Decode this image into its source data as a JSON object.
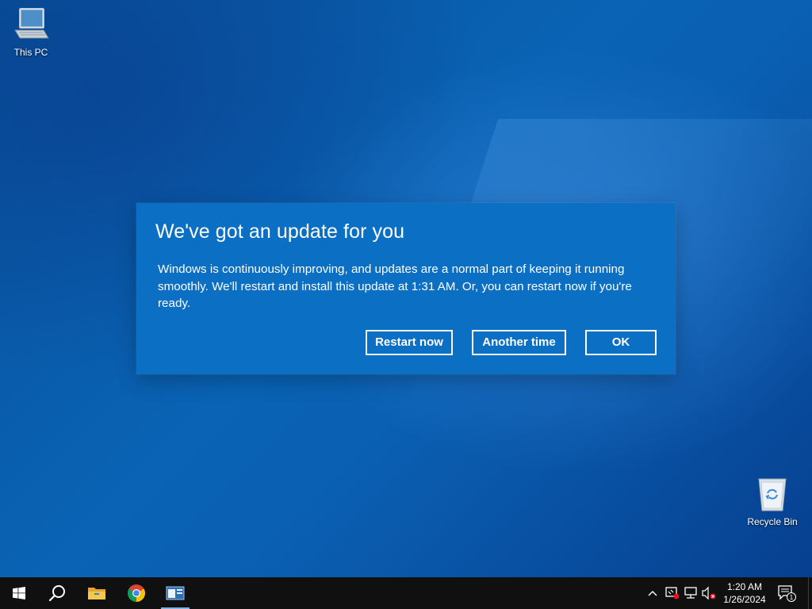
{
  "desktop": {
    "icons": [
      {
        "label": "This PC",
        "icon": "computer-icon"
      },
      {
        "label": "Recycle Bin",
        "icon": "recycle-bin-icon"
      }
    ]
  },
  "dialog": {
    "title": "We've got an update for you",
    "message": "Windows is continuously improving, and updates are a normal part of keeping it running smoothly. We'll restart and install this update at 1:31 AM. Or, you can restart now if you're ready.",
    "buttons": {
      "restart_now": "Restart now",
      "another_time": "Another time",
      "ok": "OK"
    },
    "background_color": "#0b6fc4"
  },
  "taskbar": {
    "pinned": [
      {
        "name": "start",
        "icon": "windows-logo-icon"
      },
      {
        "name": "search",
        "icon": "search-icon"
      },
      {
        "name": "file-explorer",
        "icon": "folder-icon"
      },
      {
        "name": "chrome",
        "icon": "chrome-icon"
      },
      {
        "name": "app",
        "icon": "window-app-icon"
      }
    ],
    "tray": {
      "icons": [
        "chevron-up-icon",
        "security-icon",
        "network-icon",
        "volume-muted-icon"
      ],
      "time": "1:20 AM",
      "date": "1/26/2024",
      "notifications_count": "1"
    }
  }
}
